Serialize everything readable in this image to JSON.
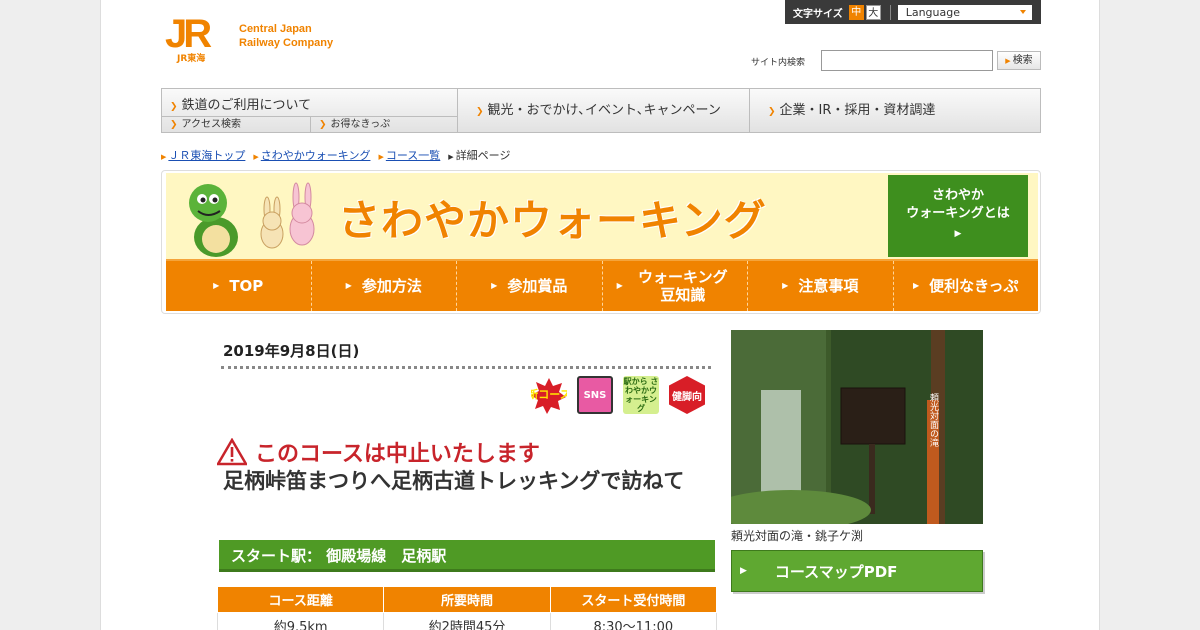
{
  "header": {
    "logo_mark": "JR",
    "logo_sub": "JR東海",
    "logo_line1": "Central Japan",
    "logo_line2": "Railway Company",
    "font_size_label": "文字サイズ",
    "font_mid": "中",
    "font_big": "大",
    "language": "Language",
    "search_label": "サイト内検索",
    "search_button": "検索"
  },
  "gnav": {
    "item1": "鉄道のご利用について",
    "item1_sub1": "アクセス検索",
    "item1_sub2": "お得なきっぷ",
    "item2": "観光・おでかけ､イベント､キャンペーン",
    "item3": "企業・IR・採用・資材調達"
  },
  "breadcrumb": {
    "home": "ＪＲ東海トップ",
    "walking": "さわやかウォーキング",
    "courses": "コース一覧",
    "current": "詳細ページ"
  },
  "banner": {
    "title": "さわやかウォーキング",
    "what_line1": "さわやか",
    "what_line2": "ウォーキングとは",
    "nav": [
      "TOP",
      "参加方法",
      "参加賞品",
      "ウォーキング豆知識",
      "注意事項",
      "便利なきっぷ"
    ]
  },
  "course": {
    "date": "2019年9月8日(日)",
    "badges": [
      "新コース",
      "SNS",
      "駅から さわやかウォーキング",
      "健脚向"
    ],
    "cancel_notice": "このコースは中止いたします",
    "title": "足柄峠笛まつりへ足柄古道トレッキングで訪ねて",
    "start_station": "スタート駅： 御殿場線　足柄駅",
    "table": {
      "headers": [
        "コース距離",
        "所要時間",
        "スタート受付時間"
      ],
      "values": [
        "約9.5km",
        "約2時間45分",
        "8:30～11:00"
      ]
    },
    "photo_caption": "頼光対面の滝・銚子ケ渕",
    "signpost": "頼光対面の滝",
    "pdf_button": "コースマップPDF"
  },
  "colors": {
    "accent": "#f08300",
    "green": "#4f9a25",
    "cancel": "#c8242b"
  }
}
